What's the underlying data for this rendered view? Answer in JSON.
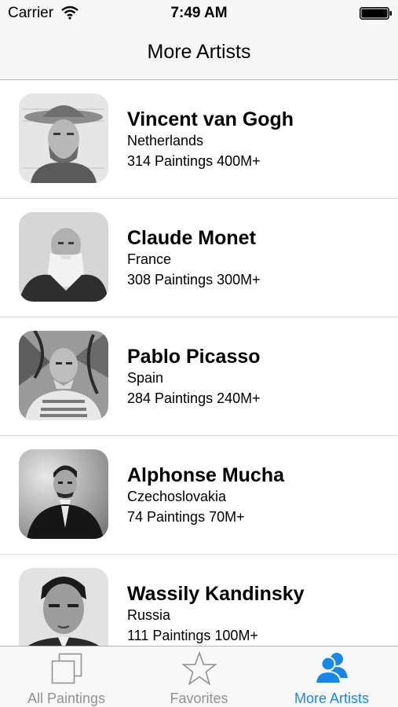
{
  "status_bar": {
    "carrier": "Carrier",
    "time": "7:49 AM"
  },
  "nav": {
    "title": "More Artists"
  },
  "artists": [
    {
      "name": "Vincent van Gogh",
      "country": "Netherlands",
      "stats": "314 Paintings 400M+"
    },
    {
      "name": "Claude Monet",
      "country": "France",
      "stats": "308 Paintings 300M+"
    },
    {
      "name": "Pablo Picasso",
      "country": "Spain",
      "stats": "284 Paintings 240M+"
    },
    {
      "name": "Alphonse Mucha",
      "country": "Czechoslovakia",
      "stats": "74 Paintings 70M+"
    },
    {
      "name": "Wassily Kandinsky",
      "country": "Russia",
      "stats": "111 Paintings 100M+"
    }
  ],
  "tabs": [
    {
      "label": "All Paintings",
      "icon": "stacked-squares-icon",
      "active": false
    },
    {
      "label": "Favorites",
      "icon": "star-icon",
      "active": false
    },
    {
      "label": "More Artists",
      "icon": "people-icon",
      "active": true
    }
  ],
  "colors": {
    "accent": "#1a86e8",
    "inactive_tab": "#929292",
    "bar_background": "#f7f7f7"
  }
}
